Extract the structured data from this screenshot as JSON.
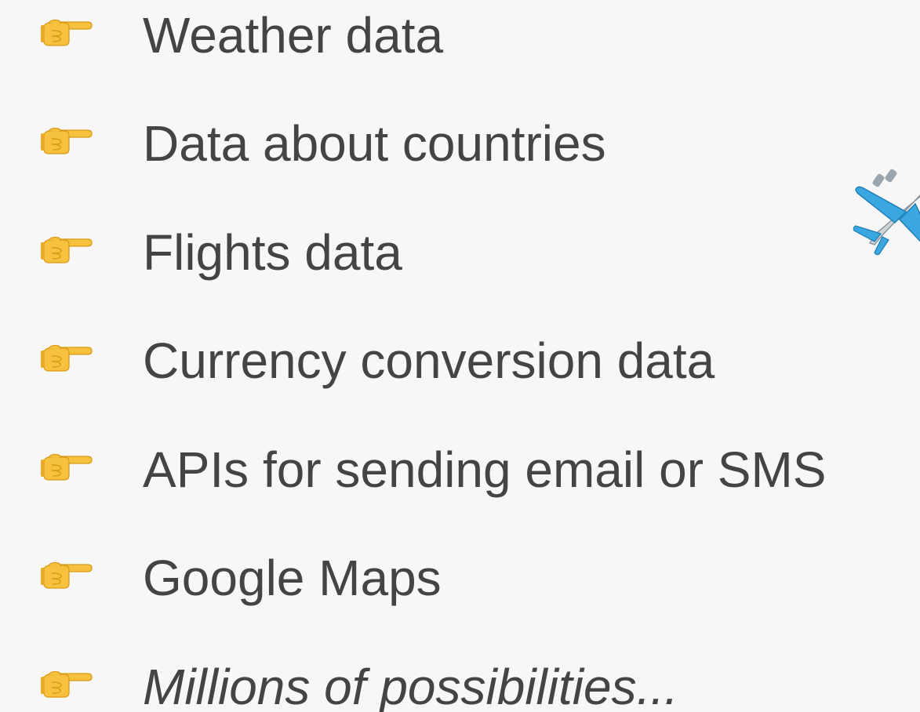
{
  "slide": {
    "items": [
      {
        "label": "Weather data",
        "icon": "pointing-hand-icon"
      },
      {
        "label": "Data about countries",
        "icon": "pointing-hand-icon"
      },
      {
        "label": "Flights data",
        "icon": "pointing-hand-icon"
      },
      {
        "label": "Currency conversion data",
        "icon": "pointing-hand-icon"
      },
      {
        "label": "APIs for sending email or SMS",
        "icon": "pointing-hand-icon"
      },
      {
        "label": "Google Maps",
        "icon": "pointing-hand-icon"
      },
      {
        "label": "Millions of possibilities...",
        "icon": "pointing-hand-icon",
        "style": "italic"
      }
    ],
    "decoration": "airplane-icon"
  },
  "colors": {
    "background": "#f7f7f7",
    "text": "#444444",
    "hand": "#f6c23e",
    "plane": "#3ba7e0"
  }
}
